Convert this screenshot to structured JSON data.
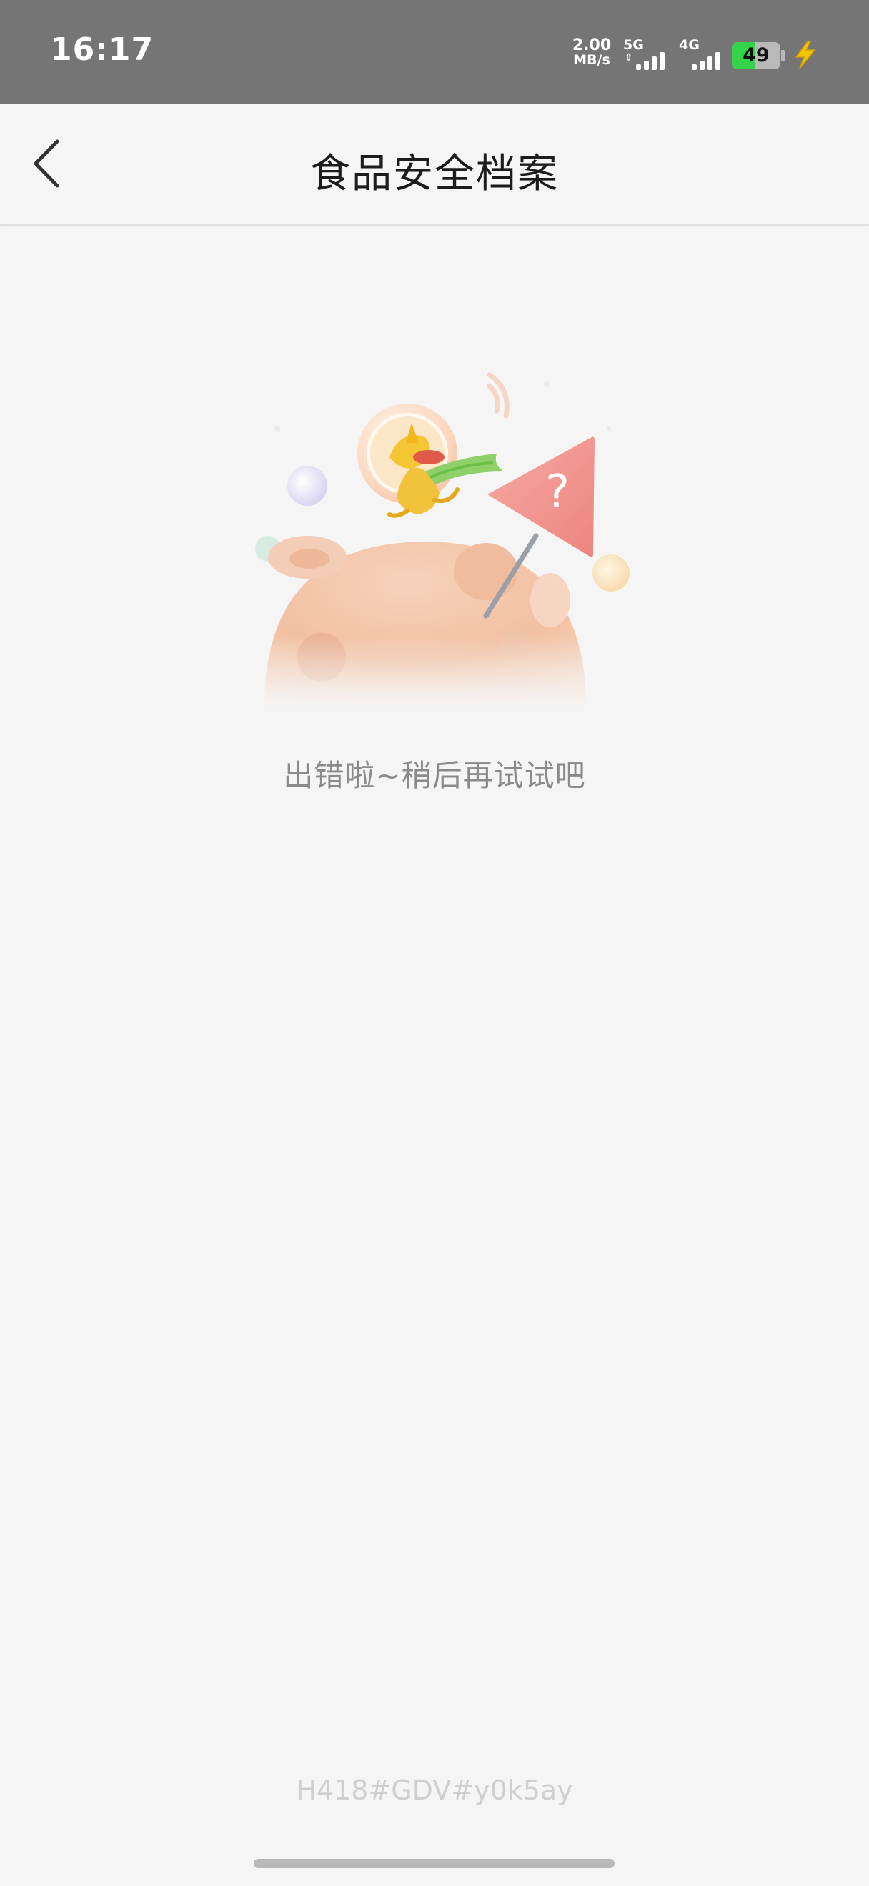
{
  "status_bar": {
    "time": "16:17",
    "net_speed_value": "2.00",
    "net_speed_unit": "MB/s",
    "signal_1_label": "5G",
    "signal_2_label": "4G",
    "battery_level": "49",
    "battery_color": "#33d34a",
    "charging_color": "#f5c400",
    "icons": [
      "signal-5g-icon",
      "signal-4g-icon",
      "battery-icon",
      "charging-bolt-icon"
    ]
  },
  "header": {
    "title": "食品安全档案",
    "back_icon": "chevron-left-icon"
  },
  "main": {
    "illustration": "error-planet-illustration",
    "error_message": "出错啦~稍后再试试吧",
    "trace_code": "H418#GDV#y0k5ay"
  },
  "theme": {
    "background": "#f5f5f5",
    "status_bar_bg": "#757575",
    "flag_color": "#f08d8a",
    "planet_color": "#f3c2a4"
  }
}
